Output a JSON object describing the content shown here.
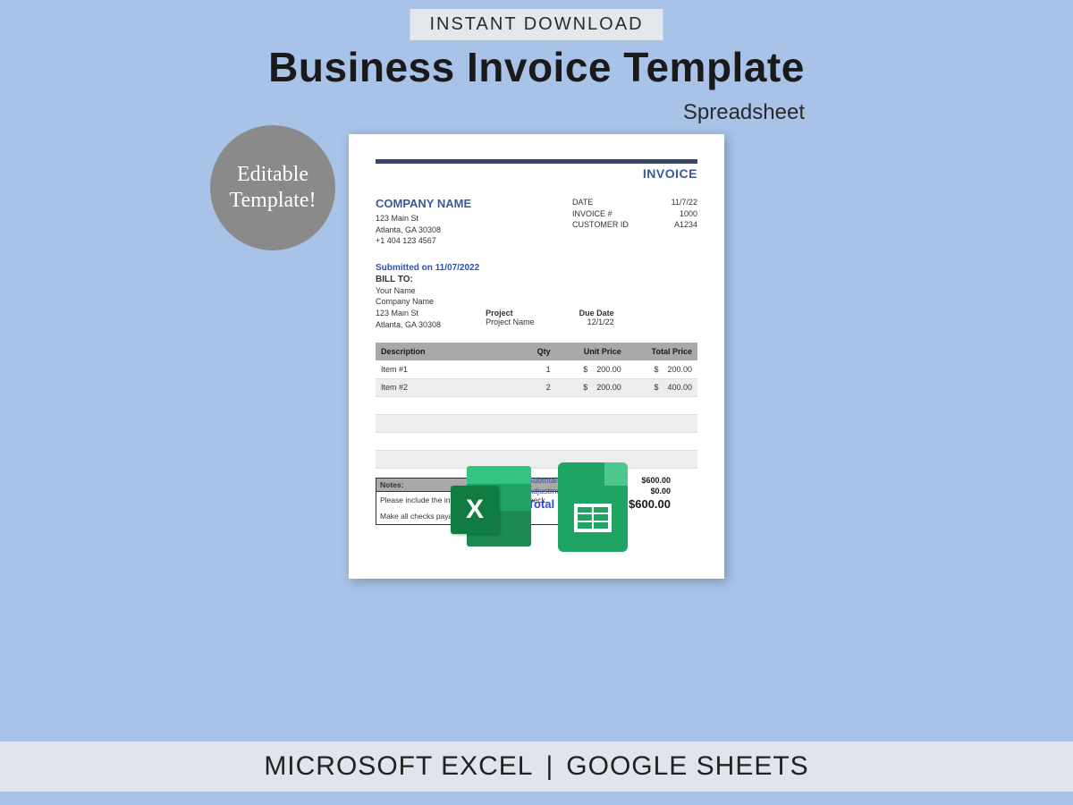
{
  "header": {
    "pill": "INSTANT DOWNLOAD",
    "title": "Business Invoice Template",
    "subtitle": "Spreadsheet"
  },
  "badge": {
    "line1": "Editable",
    "line2": "Template!"
  },
  "invoice": {
    "word": "INVOICE",
    "company_name": "COMPANY NAME",
    "address": {
      "line1": "123 Main St",
      "line2": "Atlanta, GA 30308",
      "phone": "+1 404 123 4567"
    },
    "meta": {
      "date_label": "DATE",
      "date_value": "11/7/22",
      "invoice_num_label": "INVOICE #",
      "invoice_num_value": "1000",
      "customer_id_label": "CUSTOMER ID",
      "customer_id_value": "A1234"
    },
    "submitted": "Submitted on 11/07/2022",
    "bill_to_label": "BILL TO:",
    "bill_to": {
      "name": "Your Name",
      "company": "Company Name",
      "line1": "123 Main St",
      "line2": "Atlanta, GA 30308"
    },
    "project": {
      "label": "Project",
      "value": "Project Name"
    },
    "due_date": {
      "label": "Due Date",
      "value": "12/1/22"
    },
    "columns": {
      "desc": "Description",
      "qty": "Qty",
      "unit": "Unit Price",
      "total": "Total Price"
    },
    "items": [
      {
        "desc": "Item #1",
        "qty": "1",
        "cur1": "$",
        "unit": "200.00",
        "cur2": "$",
        "total": "200.00"
      },
      {
        "desc": "Item #2",
        "qty": "2",
        "cur1": "$",
        "unit": "200.00",
        "cur2": "$",
        "total": "400.00"
      }
    ],
    "notes": {
      "header": "Notes:",
      "line1": "Please include the invoice number on your check.",
      "line2": "Make all checks payable to Company Name."
    },
    "totals": {
      "subtotal_label": "Subtotal",
      "subtotal_value": "$600.00",
      "adjustments_label": "Adjustments",
      "adjustments_value": "$0.00",
      "total_label": "Total",
      "total_value": "$600.00"
    }
  },
  "icons": {
    "excel_letter": "X"
  },
  "footer": {
    "left": "MICROSOFT EXCEL",
    "sep": "|",
    "right": "GOOGLE SHEETS"
  }
}
